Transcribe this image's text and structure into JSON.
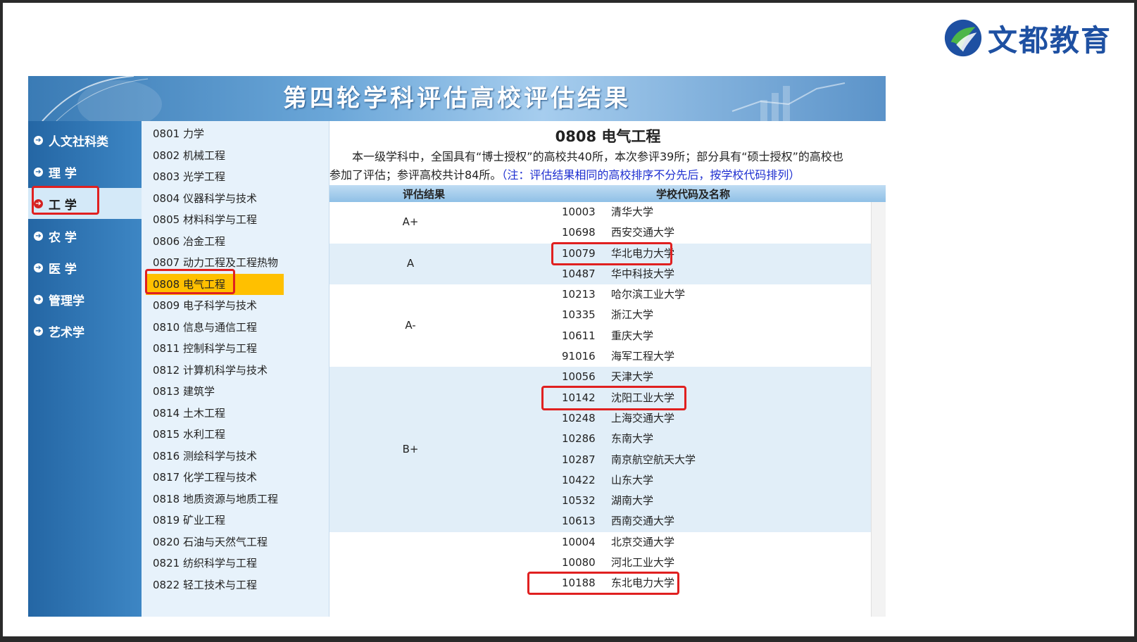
{
  "logo": {
    "text": "文都教育"
  },
  "banner": {
    "title": "第四轮学科评估高校评估结果"
  },
  "nav": {
    "items": [
      {
        "label": "人文社科类",
        "active": false
      },
      {
        "label": "理 学",
        "active": false
      },
      {
        "label": "工 学",
        "active": true
      },
      {
        "label": "农 学",
        "active": false
      },
      {
        "label": "医 学",
        "active": false
      },
      {
        "label": "管理学",
        "active": false
      },
      {
        "label": "艺术学",
        "active": false
      }
    ]
  },
  "subjects": {
    "items": [
      "0801 力学",
      "0802 机械工程",
      "0803 光学工程",
      "0804 仪器科学与技术",
      "0805 材料科学与工程",
      "0806 冶金工程",
      "0807 动力工程及工程热物理",
      "0808 电气工程",
      "0809 电子科学与技术",
      "0810 信息与通信工程",
      "0811 控制科学与工程",
      "0812 计算机科学与技术",
      "0813 建筑学",
      "0814 土木工程",
      "0815 水利工程",
      "0816 测绘科学与技术",
      "0817 化学工程与技术",
      "0818 地质资源与地质工程",
      "0819 矿业工程",
      "0820 石油与天然气工程",
      "0821 纺织科学与工程",
      "0822 轻工技术与工程"
    ],
    "active_index": 7
  },
  "content": {
    "title": "0808 电气工程",
    "intro_line1": "本一级学科中，全国具有“博士授权”的高校共40所，本次参评39所；部分具有“硕士授权”的高校也",
    "intro_line2": "参加了评估；参评高校共计84所。",
    "note": "（注：评估结果相同的高校排序不分先后，按学校代码排列）",
    "header_grade": "评估结果",
    "header_school": "学校代码及名称"
  },
  "results": [
    {
      "grade": "A+",
      "schools": [
        {
          "code": "10003",
          "name": "清华大学"
        },
        {
          "code": "10698",
          "name": "西安交通大学"
        }
      ]
    },
    {
      "grade": "A",
      "schools": [
        {
          "code": "10079",
          "name": "华北电力大学"
        },
        {
          "code": "10487",
          "name": "华中科技大学"
        }
      ]
    },
    {
      "grade": "A-",
      "schools": [
        {
          "code": "10213",
          "name": "哈尔滨工业大学"
        },
        {
          "code": "10335",
          "name": "浙江大学"
        },
        {
          "code": "10611",
          "name": "重庆大学"
        },
        {
          "code": "91016",
          "name": "海军工程大学"
        }
      ]
    },
    {
      "grade": "B+",
      "schools": [
        {
          "code": "10056",
          "name": "天津大学"
        },
        {
          "code": "10142",
          "name": "沈阳工业大学"
        },
        {
          "code": "10248",
          "name": "上海交通大学"
        },
        {
          "code": "10286",
          "name": "东南大学"
        },
        {
          "code": "10287",
          "name": "南京航空航天大学"
        },
        {
          "code": "10422",
          "name": "山东大学"
        },
        {
          "code": "10532",
          "name": "湖南大学"
        },
        {
          "code": "10613",
          "name": "西南交通大学"
        }
      ]
    },
    {
      "grade": "",
      "schools": [
        {
          "code": "10004",
          "name": "北京交通大学"
        },
        {
          "code": "10080",
          "name": "河北工业大学"
        },
        {
          "code": "10188",
          "name": "东北电力大学"
        }
      ]
    }
  ],
  "colors": {
    "highlight": "#e02020",
    "active_subject": "#ffc000",
    "nav": "#2466a4",
    "note": "#1e2fd0"
  }
}
